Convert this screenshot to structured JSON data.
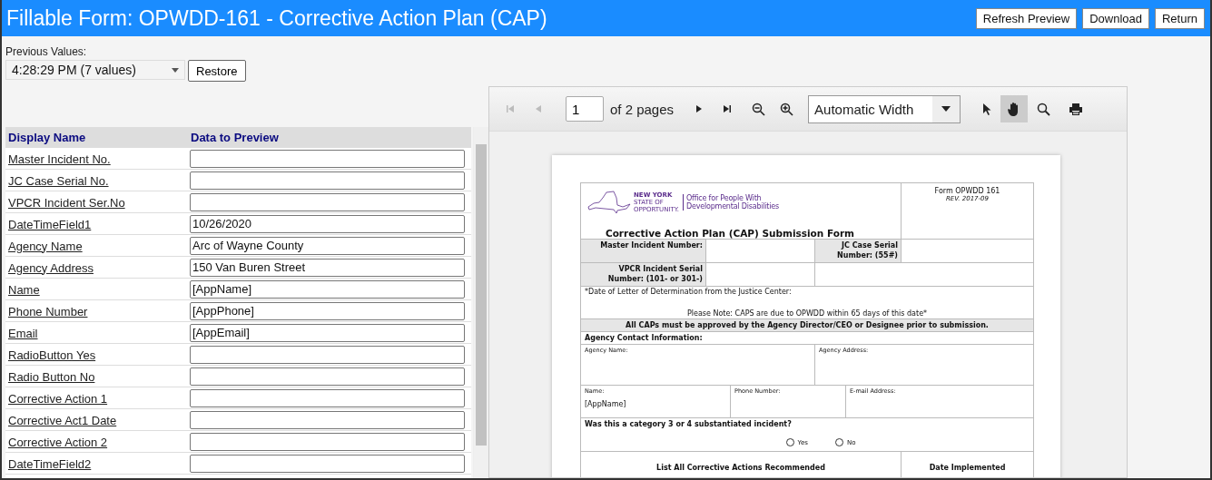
{
  "header": {
    "title": "Fillable Form: OPWDD-161 - Corrective Action Plan (CAP)",
    "buttons": [
      "Refresh Preview",
      "Download",
      "Return"
    ]
  },
  "previous_values": {
    "label": "Previous Values:",
    "value": "4:28:29 PM (7 values)",
    "button": "Restore"
  },
  "fields_table": {
    "columns": [
      "Display Name",
      "Data to Preview"
    ],
    "rows": [
      {
        "name": "Master Incident No.",
        "value": ""
      },
      {
        "name": "JC Case Serial No.",
        "value": ""
      },
      {
        "name": "VPCR Incident Ser.No",
        "value": ""
      },
      {
        "name": "DateTimeField1",
        "value": "10/26/2020"
      },
      {
        "name": "Agency Name",
        "value": "Arc of Wayne County"
      },
      {
        "name": "Agency Address",
        "value": "150 Van Buren Street"
      },
      {
        "name": "Name",
        "value": "[AppName]"
      },
      {
        "name": "Phone Number",
        "value": "[AppPhone]"
      },
      {
        "name": "Email",
        "value": "[AppEmail]"
      },
      {
        "name": "RadioButton Yes",
        "value": ""
      },
      {
        "name": "Radio Button No",
        "value": ""
      },
      {
        "name": "Corrective Action 1",
        "value": ""
      },
      {
        "name": "Corrective Act1 Date",
        "value": ""
      },
      {
        "name": "Corrective Action 2",
        "value": ""
      },
      {
        "name": "DateTimeField2",
        "value": ""
      }
    ]
  },
  "pdf_viewer": {
    "toolbar": {
      "page_number": "1",
      "page_count": "of 2 pages",
      "zoom": "Automatic Width",
      "tools": [
        {
          "kind": "pointer",
          "selected": false
        },
        {
          "kind": "hand",
          "selected": true
        }
      ]
    },
    "document": {
      "form_number": "Form OPWDD 161",
      "revision": "REV. 2017-09",
      "logo_state": "NEW YORK",
      "logo_tagline": "STATE OF OPPORTUNITY.",
      "agency": "Office for People With Developmental Disabilities",
      "title": "Corrective Action Plan (CAP) Submission Form",
      "master_incident_label": "Master Incident Number:",
      "jc_case_label": "JC Case Serial Number: (55#)",
      "vpcr_label": "VPCR Incident Serial Number: (101- or 301-)",
      "date_letter_label": "*Date of Letter of Determination from the Justice Center:",
      "please_note": "Please Note:  CAPS are due to OPWDD within 65 days of this date*",
      "approval_note": "All CAPs must be approved by the Agency Director/CEO or Designee prior to submission.",
      "contact_heading": "Agency Contact Information:",
      "agency_name_label": "Agency Name:",
      "agency_address_label": "Agency Address:",
      "name_label": "Name:",
      "name_value": "[AppName]",
      "phone_label": "Phone Number:",
      "email_label": "E-mail Address:",
      "question": "Was this a category 3 or 4 substantiated incident?",
      "options": [
        {
          "label": "Yes",
          "selected": false
        },
        {
          "label": "No",
          "selected": false
        }
      ],
      "actions_heading": "List All Corrective Actions Recommended",
      "date_heading": "Date Implemented"
    }
  }
}
